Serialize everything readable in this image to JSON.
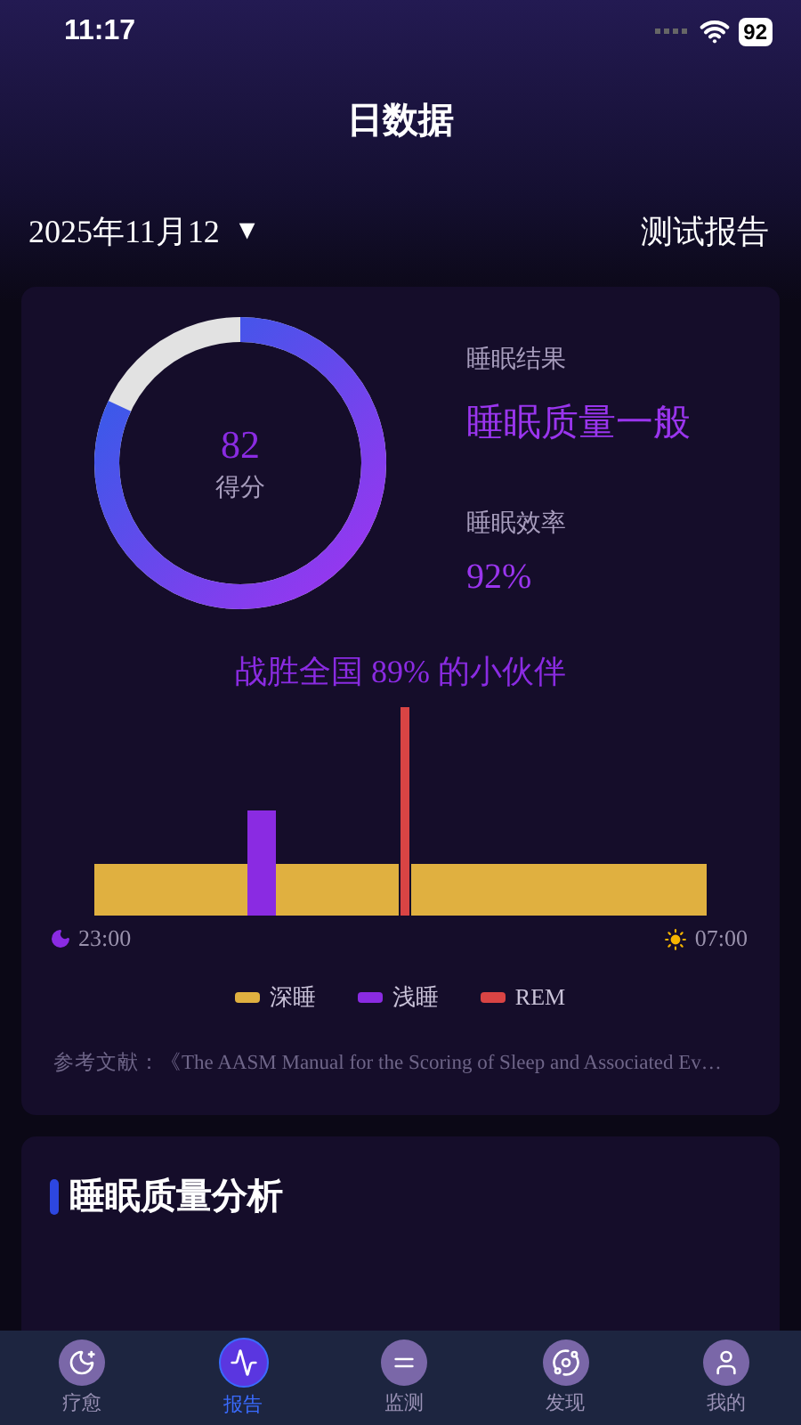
{
  "status_bar": {
    "time": "11:17",
    "battery": "92"
  },
  "header": {
    "title": "日数据"
  },
  "toolbar": {
    "date": "2025年11月12",
    "dropdown_glyph": "▼",
    "report_link": "测试报告"
  },
  "summary_card": {
    "score": {
      "value": "82",
      "label": "得分",
      "level": 0.82
    },
    "result_label": "睡眠结果",
    "result_value": "睡眠质量一般",
    "efficiency_label": "睡眠效率",
    "efficiency_value": "92%",
    "ranking": "战胜全国 89% 的小伙伴",
    "start_time": "23:00",
    "end_time": "07:00",
    "legend": [
      {
        "label": "深睡",
        "color": "#e0b040"
      },
      {
        "label": "浅睡",
        "color": "#8a2be2"
      },
      {
        "label": "REM",
        "color": "#d94444"
      }
    ],
    "reference": "参考文献：《The AASM Manual for the Scoring of Sleep and Associated Ev…"
  },
  "analysis_card": {
    "title": "睡眠质量分析"
  },
  "tab_bar": [
    {
      "label": "疗愈",
      "kind": "moon",
      "selected": false
    },
    {
      "label": "报告",
      "kind": "pulse",
      "selected": true
    },
    {
      "label": "监测",
      "kind": "equal",
      "selected": false
    },
    {
      "label": "发现",
      "kind": "planet",
      "selected": false
    },
    {
      "label": "我的",
      "kind": "user",
      "selected": false
    }
  ]
}
